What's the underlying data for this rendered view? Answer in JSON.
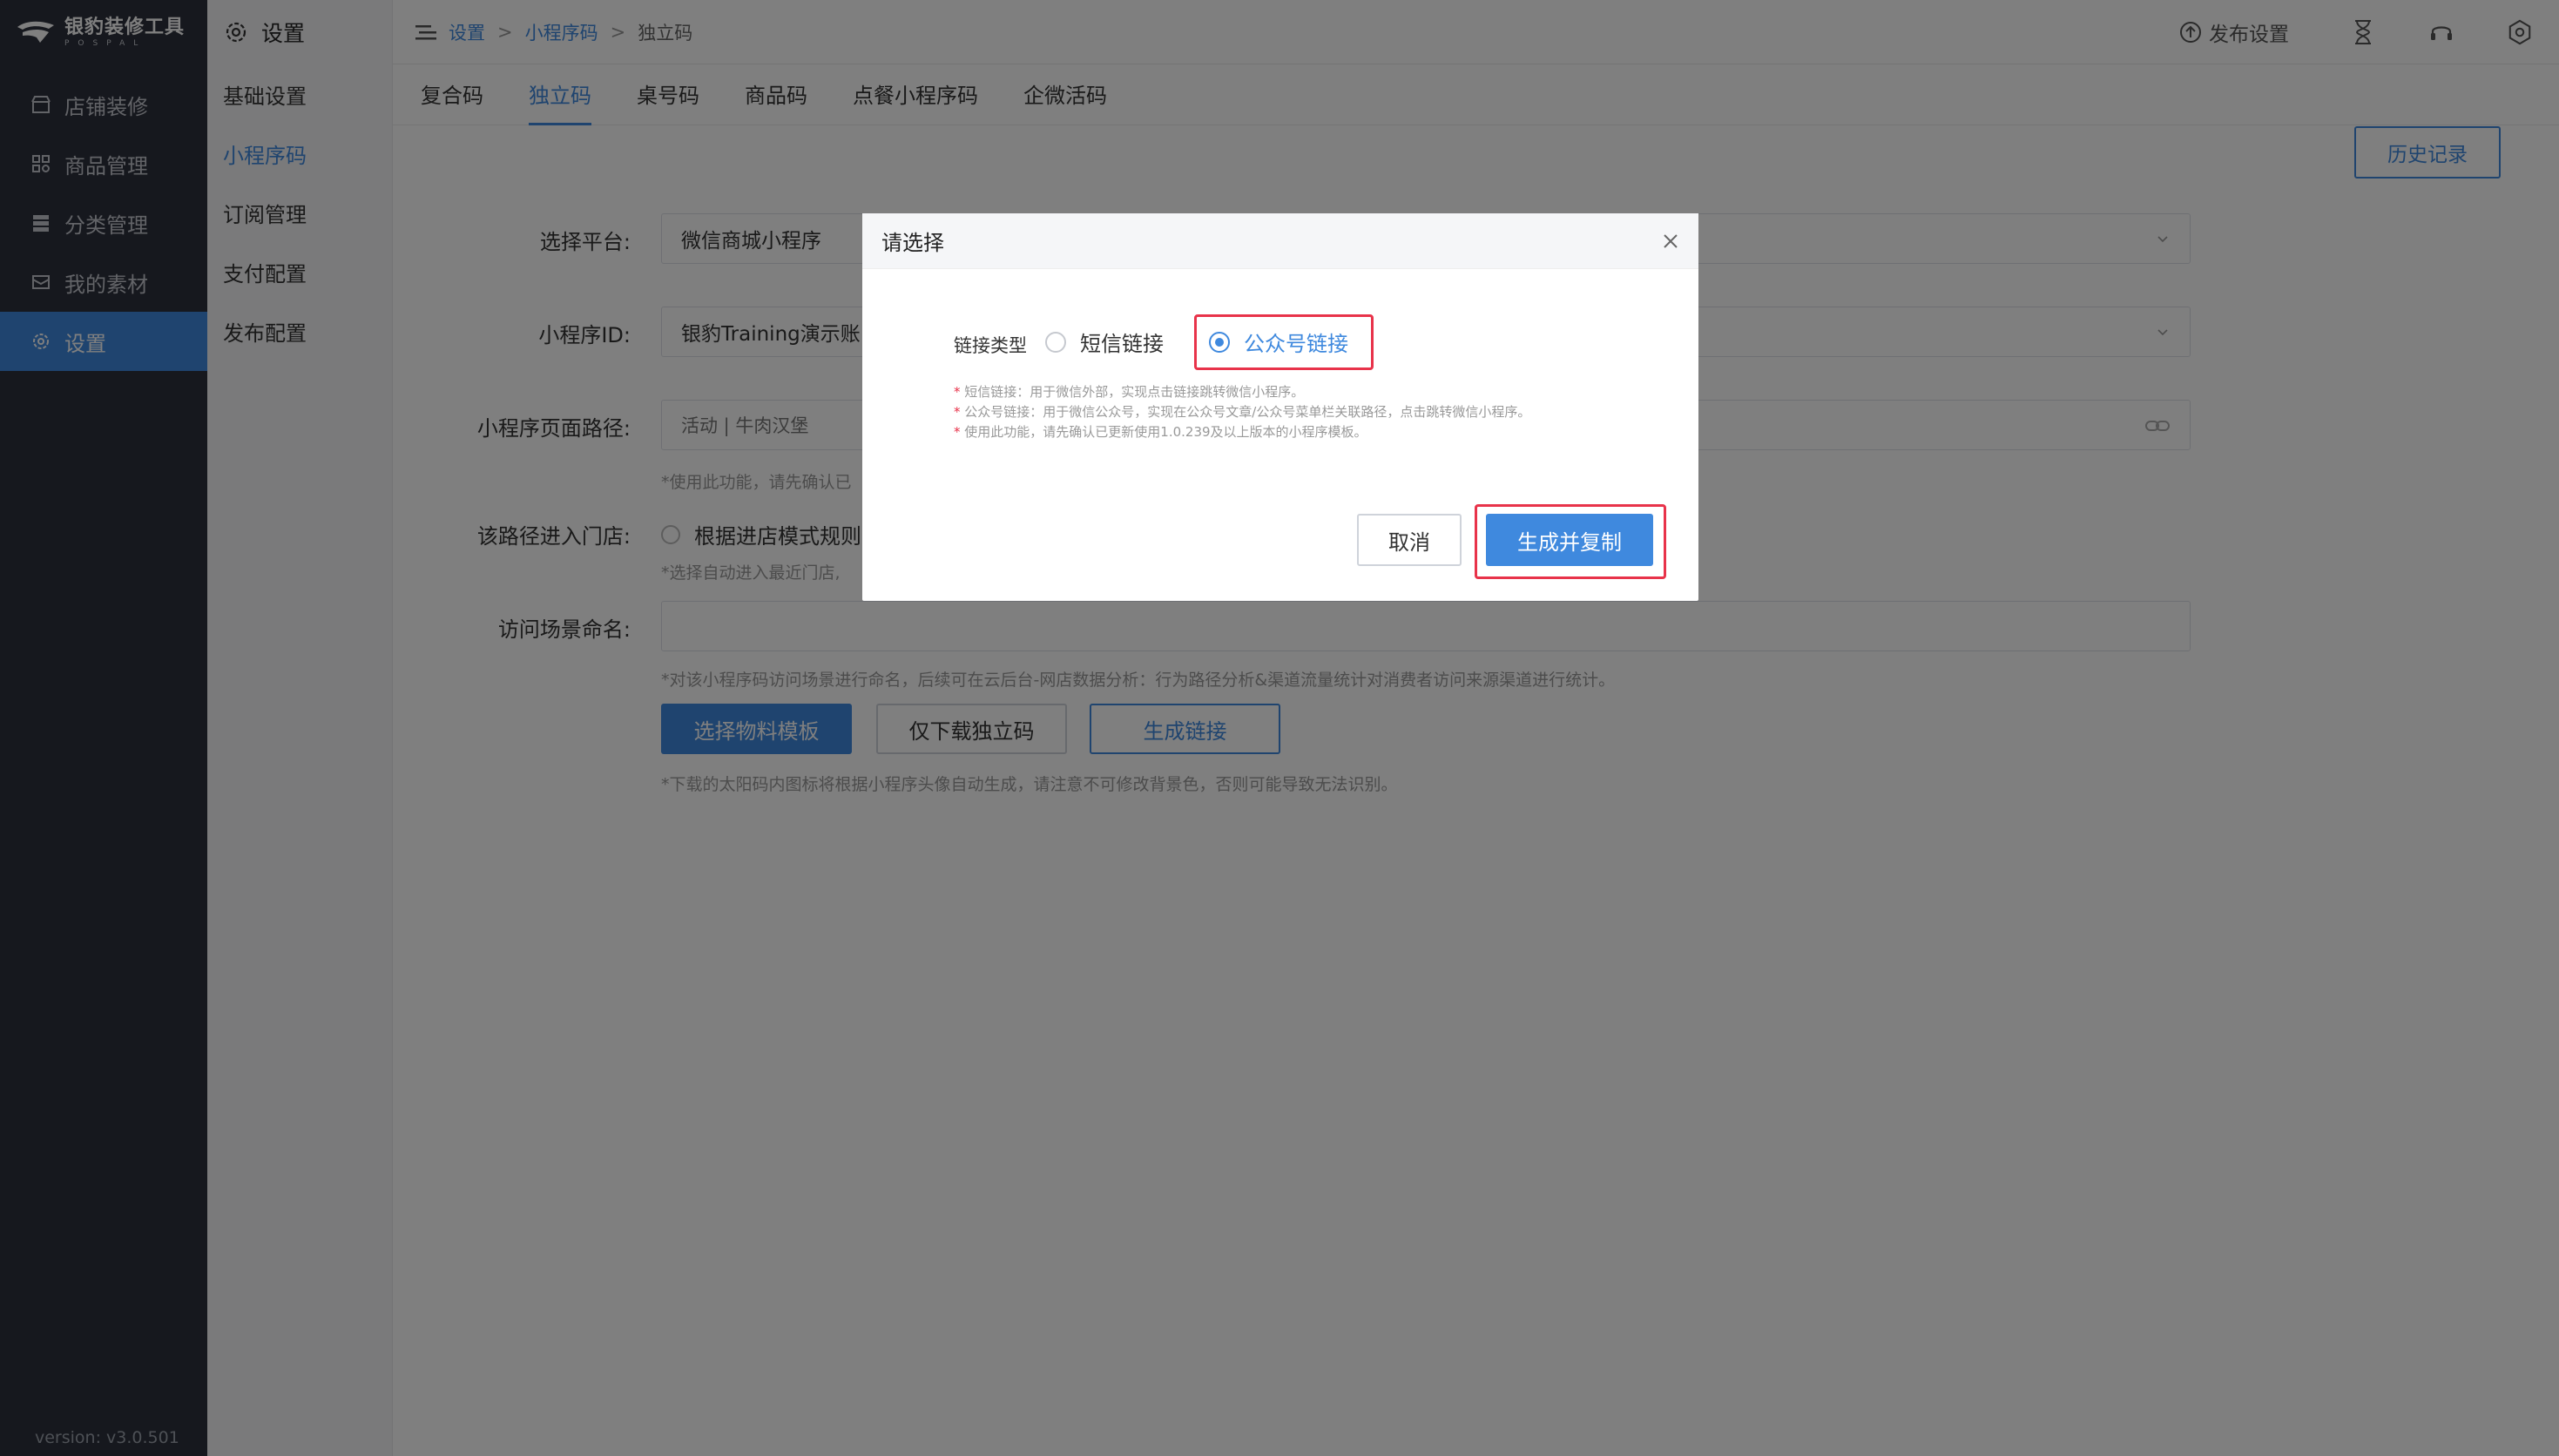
{
  "app": {
    "logo_name": "银豹装修工具",
    "logo_sub": "POSPAL",
    "version": "version: v3.0.501"
  },
  "sidebar": {
    "items": [
      {
        "label": "店铺装修",
        "icon": "store-icon"
      },
      {
        "label": "商品管理",
        "icon": "grid-icon"
      },
      {
        "label": "分类管理",
        "icon": "list-icon"
      },
      {
        "label": "我的素材",
        "icon": "image-icon"
      },
      {
        "label": "设置",
        "icon": "gear-icon",
        "active": true
      }
    ]
  },
  "subnav": {
    "title": "设置",
    "items": [
      {
        "label": "基础设置"
      },
      {
        "label": "小程序码",
        "active": true
      },
      {
        "label": "订阅管理"
      },
      {
        "label": "支付配置"
      },
      {
        "label": "发布配置"
      }
    ]
  },
  "topbar": {
    "breadcrumb": [
      "设置",
      "小程序码",
      "独立码"
    ],
    "separator": ">",
    "publish_settings": "发布设置"
  },
  "tabs": [
    {
      "label": "复合码"
    },
    {
      "label": "独立码",
      "active": true
    },
    {
      "label": "桌号码"
    },
    {
      "label": "商品码"
    },
    {
      "label": "点餐小程序码"
    },
    {
      "label": "企微活码"
    }
  ],
  "history_button": "历史记录",
  "form": {
    "platform_label": "选择平台:",
    "platform_value": "微信商城小程序",
    "appid_label": "小程序ID:",
    "appid_value": "银豹Training演示账",
    "path_label": "小程序页面路径:",
    "path_value": "活动 | 牛肉汉堡",
    "path_hint": "*使用此功能，请先确认已",
    "store_label": "该路径进入门店:",
    "store_option": "根据进店模式规则",
    "store_hint": "*选择自动进入最近门店,",
    "scene_label": "访问场景命名:",
    "scene_value": "",
    "scene_hint": "*对该小程序码访问场景进行命名，后续可在云后台-网店数据分析：行为路径分析&渠道流量统计对消费者访问来源渠道进行统计。",
    "btn_template": "选择物料模板",
    "btn_download": "仅下载独立码",
    "btn_link": "生成链接",
    "download_hint": "*下载的太阳码内图标将根据小程序头像自动生成，请注意不可修改背景色，否则可能导致无法识别。"
  },
  "dialog": {
    "title": "请选择",
    "link_type_label": "链接类型",
    "option_sms": "短信链接",
    "option_official": "公众号链接",
    "selected": "option_official",
    "notes": [
      "短信链接：用于微信外部，实现点击链接跳转微信小程序。",
      "公众号链接：用于微信公众号，实现在公众号文章/公众号菜单栏关联路径，点击跳转微信小程序。",
      "使用此功能，请先确认已更新使用1.0.239及以上版本的小程序模板。"
    ],
    "cancel": "取消",
    "confirm": "生成并复制"
  },
  "colors": {
    "accent": "#3f89de",
    "sidebar_bg": "#2d313c",
    "highlight_red": "#e8334a",
    "mask": "rgba(0,0,0,0.5)"
  }
}
